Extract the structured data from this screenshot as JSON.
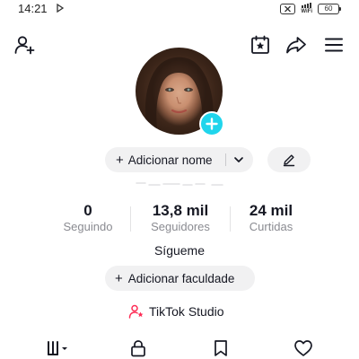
{
  "status_bar": {
    "time": "14:21",
    "wifi_label": "WiFi",
    "battery": "60"
  },
  "header": {
    "icons": [
      "add-friend-icon",
      "calendar-star-icon",
      "share-icon",
      "menu-icon"
    ]
  },
  "profile": {
    "add_name_button": "Adicionar nome",
    "bio": "Sígueme",
    "add_college_button": "Adicionar faculdade",
    "studio_link": "TikTok Studio"
  },
  "stats": [
    {
      "value": "0",
      "label": "Seguindo"
    },
    {
      "value": "13,8 mil",
      "label": "Seguidores"
    },
    {
      "value": "24 mil",
      "label": "Curtidas"
    }
  ],
  "tabs": [
    "videos-grid-icon",
    "lock-icon",
    "bookmark-icon",
    "heart-icon"
  ],
  "colors": {
    "accent": "#20d5ec",
    "studio_icon": "#fe2c55",
    "pill_bg": "#f1f1f2",
    "muted_text": "#8a8b91"
  }
}
